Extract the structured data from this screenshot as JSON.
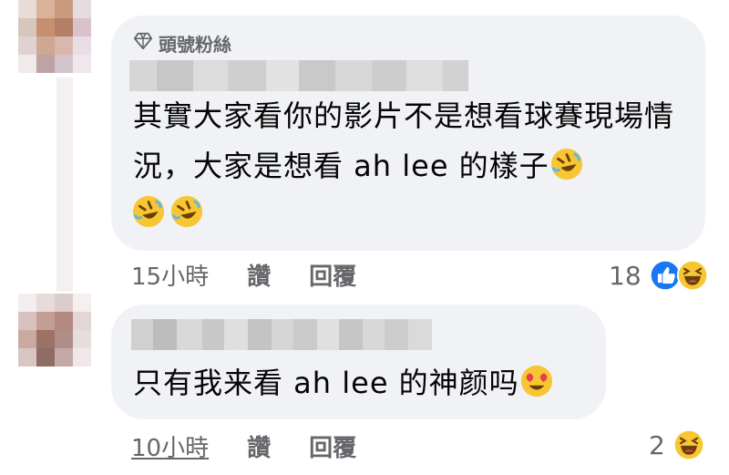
{
  "comments": [
    {
      "badge_label": "頭號粉絲",
      "badge_icon": "diamond-icon",
      "text": "其實大家看你的影片不是想看球賽現場情況，大家是想看 ah lee 的樣子",
      "time": "15小時",
      "like_label": "讚",
      "reply_label": "回覆",
      "reaction_count": "18",
      "reaction_icons": [
        "like-icon",
        "laugh-icon"
      ],
      "inline_emoji": [
        "rofl-emoji",
        "rofl-emoji",
        "rofl-emoji"
      ]
    },
    {
      "text": "只有我来看 ah lee 的神颜吗",
      "time": "10小時",
      "like_label": "讚",
      "reply_label": "回覆",
      "reaction_count": "2",
      "reaction_icons": [
        "laugh-icon"
      ],
      "inline_emoji": [
        "heart-eyes-emoji"
      ]
    }
  ],
  "colors": {
    "bubble_bg": "#f0f2f5",
    "meta_text": "#65676b",
    "body_text": "#050505",
    "like_blue": "#1877f2",
    "emoji_yellow": "#f7c633"
  }
}
